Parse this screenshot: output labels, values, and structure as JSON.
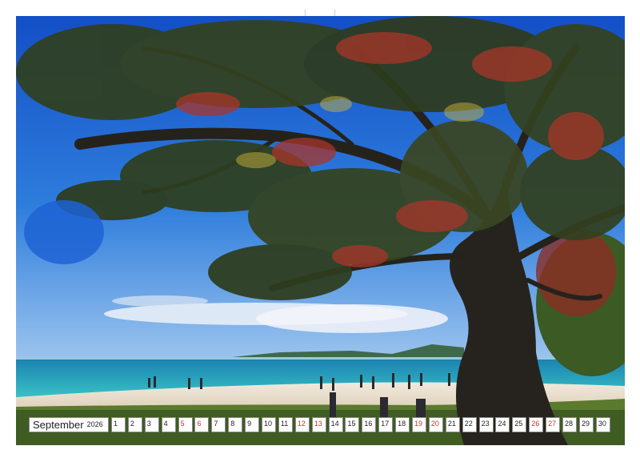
{
  "calendar": {
    "month": "September",
    "year": "2026",
    "days": [
      {
        "n": "1",
        "weekend": false
      },
      {
        "n": "2",
        "weekend": false
      },
      {
        "n": "3",
        "weekend": false
      },
      {
        "n": "4",
        "weekend": false
      },
      {
        "n": "5",
        "weekend": true
      },
      {
        "n": "6",
        "weekend": true
      },
      {
        "n": "7",
        "weekend": false
      },
      {
        "n": "8",
        "weekend": false
      },
      {
        "n": "9",
        "weekend": false
      },
      {
        "n": "10",
        "weekend": false
      },
      {
        "n": "11",
        "weekend": false
      },
      {
        "n": "12",
        "weekend": true
      },
      {
        "n": "13",
        "weekend": true
      },
      {
        "n": "14",
        "weekend": false
      },
      {
        "n": "15",
        "weekend": false
      },
      {
        "n": "16",
        "weekend": false
      },
      {
        "n": "17",
        "weekend": false
      },
      {
        "n": "18",
        "weekend": false
      },
      {
        "n": "19",
        "weekend": true
      },
      {
        "n": "20",
        "weekend": true
      },
      {
        "n": "21",
        "weekend": false
      },
      {
        "n": "22",
        "weekend": false
      },
      {
        "n": "23",
        "weekend": false
      },
      {
        "n": "24",
        "weekend": false
      },
      {
        "n": "25",
        "weekend": false
      },
      {
        "n": "26",
        "weekend": true
      },
      {
        "n": "27",
        "weekend": true
      },
      {
        "n": "28",
        "weekend": false
      },
      {
        "n": "29",
        "weekend": false
      },
      {
        "n": "30",
        "weekend": false
      }
    ]
  },
  "colors": {
    "sky_top": "#1a5fd0",
    "sky_bottom": "#7fb2ea",
    "sea": "#1e9fb8",
    "sand": "#e9dfcf",
    "grass": "#4d6b2a",
    "trunk": "#2a2620",
    "foliage_dark": "#2f3f1f",
    "foliage_red": "#a8352a",
    "weekend_text": "#c0392b"
  }
}
